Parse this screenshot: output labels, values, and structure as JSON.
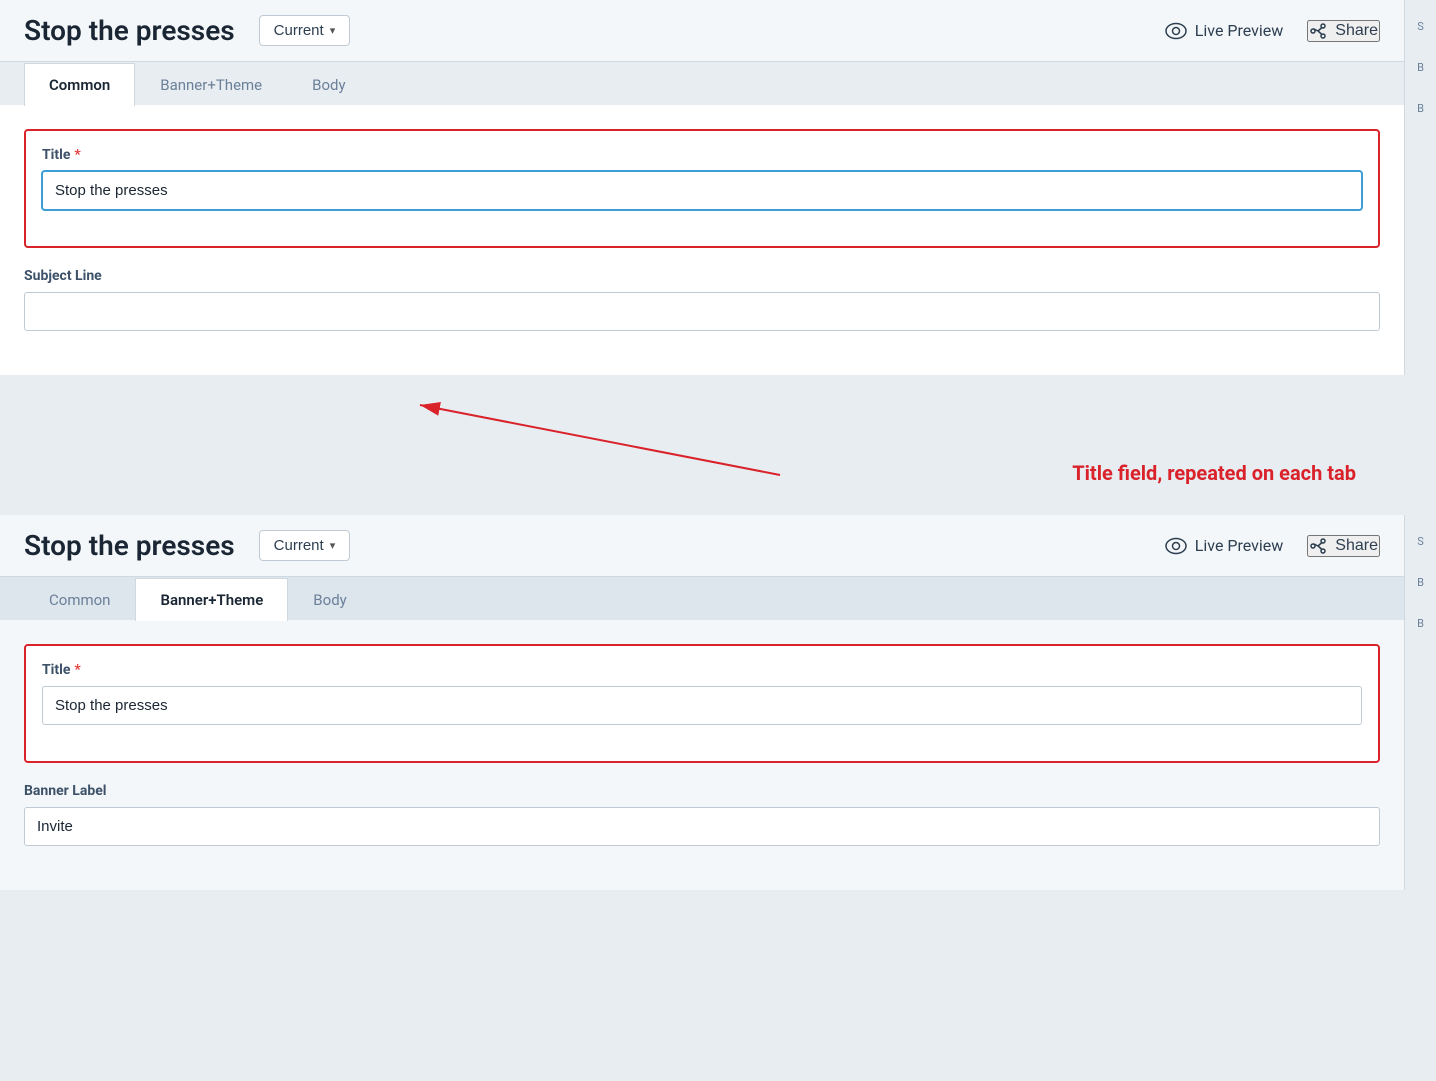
{
  "app": {
    "title": "Stop the presses"
  },
  "header": {
    "page_title": "Stop the presses",
    "version_label": "Current",
    "live_preview_label": "Live Preview",
    "share_label": "Share"
  },
  "tabs_top": {
    "items": [
      {
        "label": "Common",
        "active": true
      },
      {
        "label": "Banner+Theme",
        "active": false
      },
      {
        "label": "Body",
        "active": false
      }
    ]
  },
  "tabs_bottom": {
    "items": [
      {
        "label": "Common",
        "active": false
      },
      {
        "label": "Banner+Theme",
        "active": true
      },
      {
        "label": "Body",
        "active": false
      }
    ]
  },
  "form_top": {
    "title_label": "Title",
    "title_value": "Stop the presses",
    "subject_line_label": "Subject Line",
    "subject_line_value": ""
  },
  "form_bottom": {
    "title_label": "Title",
    "title_value": "Stop the presses",
    "banner_label_label": "Banner Label",
    "banner_label_value": "Invite"
  },
  "annotation": {
    "text": "Title field, repeated on each tab"
  },
  "right_sidebar_top": {
    "chars": [
      "S",
      "B",
      "B"
    ]
  },
  "right_sidebar_bottom": {
    "chars": [
      "S",
      "B",
      "B"
    ]
  }
}
